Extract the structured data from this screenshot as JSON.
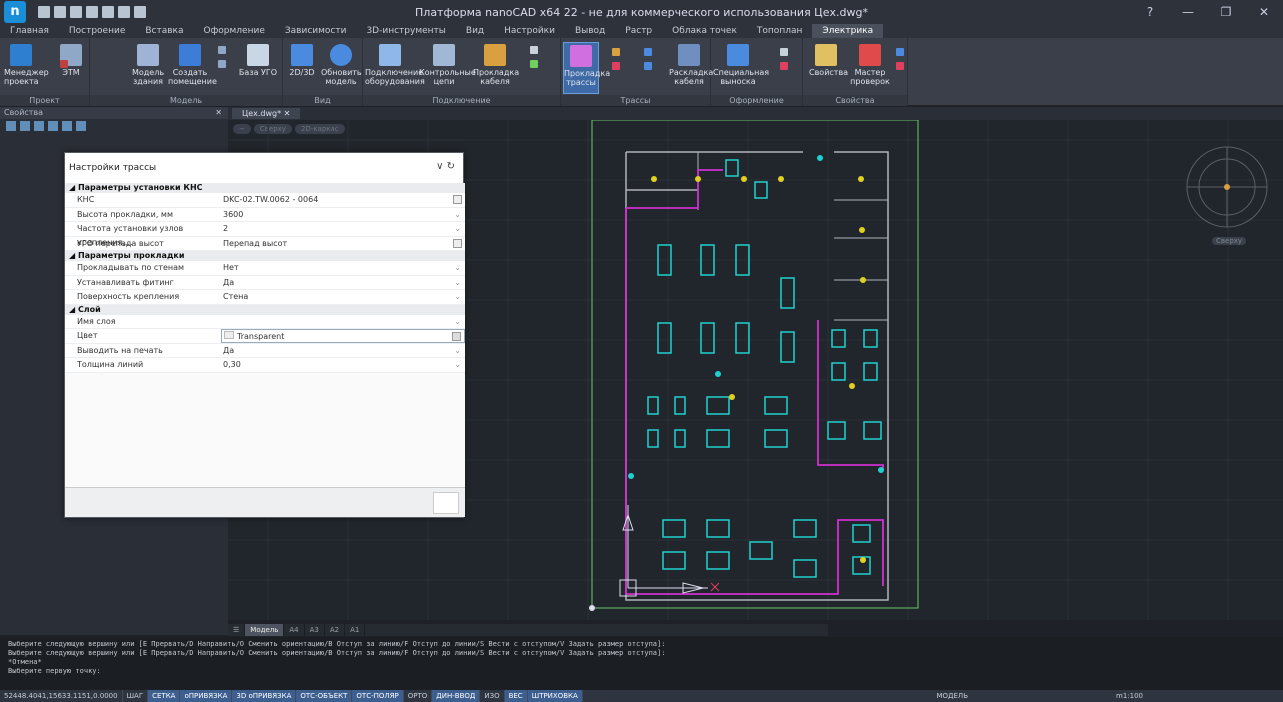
{
  "app": {
    "title": "Платформа nanoCAD x64 22 - не для коммерческого использования Цех.dwg*",
    "logo": "nanoCAD logo",
    "window_controls": [
      "?",
      "—",
      "❐",
      "✕"
    ]
  },
  "tabs": [
    "Главная",
    "Построение",
    "Вставка",
    "Оформление",
    "Зависимости",
    "3D-инструменты",
    "Вид",
    "Настройки",
    "Вывод",
    "Растр",
    "Облака точек",
    "Топоплан",
    "Электрика"
  ],
  "active_tab": "Электрика",
  "ribbon": {
    "groups": [
      {
        "label": "Проект",
        "buttons": [
          "Менеджер проекта",
          "ЭТМ"
        ]
      },
      {
        "label": "Модель",
        "buttons": [
          "Модель здания",
          "Создать помещение",
          "База УГО"
        ]
      },
      {
        "label": "Вид",
        "buttons": [
          "2D/3D",
          "Обновить модель"
        ]
      },
      {
        "label": "Подключение",
        "buttons": [
          "Подключение оборудования",
          "Контрольные цепи",
          "Прокладка кабеля"
        ]
      },
      {
        "label": "Трассы",
        "buttons": [
          "Прокладка трассы",
          "Раскладка кабеля"
        ]
      },
      {
        "label": "Оформление",
        "buttons": [
          "Специальная выноска"
        ]
      },
      {
        "label": "Свойства",
        "buttons": [
          "Свойства",
          "Мастер проверок"
        ]
      }
    ],
    "selected_button": "Прокладка трассы",
    "accent": "#3e6aa6"
  },
  "left_panel": {
    "title": "Свойства",
    "close": "✕"
  },
  "doc_tab": {
    "label": "Цех.dwg*",
    "close": "✕"
  },
  "view_labels": [
    "Сверху",
    "2D-каркас"
  ],
  "viewcube_label": "Сверху",
  "dialog": {
    "title": "Настройки трассы",
    "header_controls": "∨ ↻",
    "sections": [
      {
        "title": "Параметры установки КНС",
        "rows": [
          {
            "key": "КНС",
            "value": "DKC-02.TW.0062 - 0064",
            "control": "box"
          },
          {
            "key": "Высота прокладки, мм",
            "value": "3600",
            "control": "dd"
          },
          {
            "key": "Частота установки узлов крепления,...",
            "value": "2",
            "control": "dd"
          },
          {
            "key": "УГО перепада высот",
            "value": "Перепад высот",
            "control": "box"
          }
        ]
      },
      {
        "title": "Параметры прокладки",
        "rows": [
          {
            "key": "Прокладывать по стенам",
            "value": "Нет",
            "control": "dd"
          },
          {
            "key": "Устанавливать фитинг",
            "value": "Да",
            "control": "dd"
          },
          {
            "key": "Поверхность крепления",
            "value": "Стена",
            "control": "dd"
          }
        ]
      },
      {
        "title": "Слой",
        "rows": [
          {
            "key": "Имя слоя",
            "value": "",
            "control": "dd"
          },
          {
            "key": "Цвет",
            "value": "Transparent",
            "control": "box"
          },
          {
            "key": "Выводить на печать",
            "value": "Да",
            "control": "dd"
          },
          {
            "key": "Толщина линий",
            "value": "0,30",
            "control": "dd"
          }
        ]
      }
    ]
  },
  "layout_tabs": [
    "Модель",
    "A4",
    "A3",
    "A2",
    "A1"
  ],
  "command_lines": [
    "Выберите следующую вершину или [E Прервать/D Направить/O Сменить ориентацию/B Отступ за линию/F Отступ до линии/S Вести с отступом/V Задать размер отступа]:",
    "Выберите следующую вершину или [E Прервать/D Направить/O Сменить ориентацию/B Отступ за линию/F Отступ до линии/S Вести с отступом/V Задать размер отступа]:",
    "*Отмена*",
    "Выберите первую точку:"
  ],
  "status": {
    "coords": "52448.4041,15633.1151,0.0000",
    "toggles": [
      {
        "label": "ШАГ",
        "on": false
      },
      {
        "label": "СЕТКА",
        "on": true
      },
      {
        "label": "оПРИВЯЗКА",
        "on": true
      },
      {
        "label": "3D оПРИВЯЗКА",
        "on": true
      },
      {
        "label": "ОТС-ОБЪЕКТ",
        "on": true
      },
      {
        "label": "ОТС-ПОЛЯР",
        "on": true
      },
      {
        "label": "ОРТО",
        "on": false
      },
      {
        "label": "ДИН-ВВОД",
        "on": true
      },
      {
        "label": "ИЗО",
        "on": false
      },
      {
        "label": "ВЕС",
        "on": true
      },
      {
        "label": "ШТРИХОВКА",
        "on": true
      }
    ],
    "model_label": "МОДЕЛЬ",
    "scale": "m1:100"
  }
}
